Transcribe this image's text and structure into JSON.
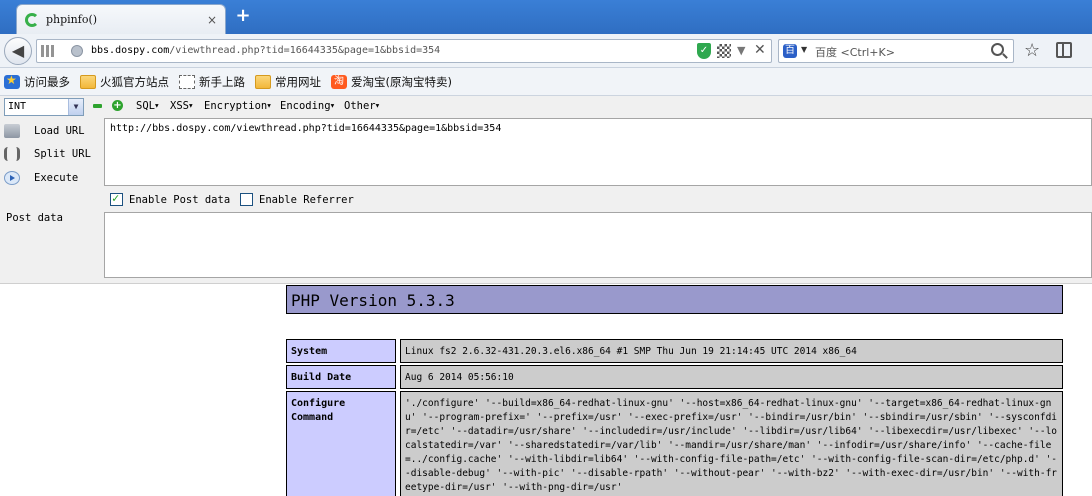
{
  "tab": {
    "title": "phpinfo()",
    "close": "×",
    "new_tab": "+"
  },
  "nav": {
    "back": "◀",
    "url_host": "bbs.dospy.com",
    "url_path": "/viewthread.php?tid=16644335&page=1&bbsid=354",
    "dropdown": "▼",
    "clear": "✕"
  },
  "search": {
    "engine": "百",
    "placeholder": "百度 <Ctrl+K>"
  },
  "bookmarks": [
    {
      "label": "访问最多"
    },
    {
      "label": "火狐官方站点"
    },
    {
      "label": "新手上路"
    },
    {
      "label": "常用网址"
    },
    {
      "label": "爱淘宝(原淘宝特卖)"
    }
  ],
  "hackbar": {
    "select": "INT",
    "menus": [
      "SQL",
      "XSS",
      "Encryption",
      "Encoding",
      "Other"
    ],
    "load_url": "Load URL",
    "split_url": "Split URL",
    "execute": "Execute",
    "url_value": "http://bbs.dospy.com/viewthread.php?tid=16644335&page=1&bbsid=354",
    "enable_post": "Enable Post data",
    "enable_referrer": "Enable Referrer",
    "post_label": "Post data",
    "post_checked": true,
    "referrer_checked": false
  },
  "php": {
    "version": "PHP Version 5.3.3",
    "rows": [
      {
        "key": "System",
        "value": "Linux fs2 2.6.32-431.20.3.el6.x86_64 #1 SMP Thu Jun 19 21:14:45 UTC 2014 x86_64"
      },
      {
        "key": "Build Date",
        "value": "Aug 6 2014 05:56:10"
      },
      {
        "key": "Configure Command",
        "value": "'./configure' '--build=x86_64-redhat-linux-gnu' '--host=x86_64-redhat-linux-gnu' '--target=x86_64-redhat-linux-gnu' '--program-prefix=' '--prefix=/usr' '--exec-prefix=/usr' '--bindir=/usr/bin' '--sbindir=/usr/sbin' '--sysconfdir=/etc' '--datadir=/usr/share' '--includedir=/usr/include' '--libdir=/usr/lib64' '--libexecdir=/usr/libexec' '--localstatedir=/var' '--sharedstatedir=/var/lib' '--mandir=/usr/share/man' '--infodir=/usr/share/info' '--cache-file=../config.cache' '--with-libdir=lib64' '--with-config-file-path=/etc' '--with-config-file-scan-dir=/etc/php.d' '--disable-debug' '--with-pic' '--disable-rpath' '--without-pear' '--with-bz2' '--with-exec-dir=/usr/bin' '--with-freetype-dir=/usr' '--with-png-dir=/usr'"
      }
    ]
  }
}
